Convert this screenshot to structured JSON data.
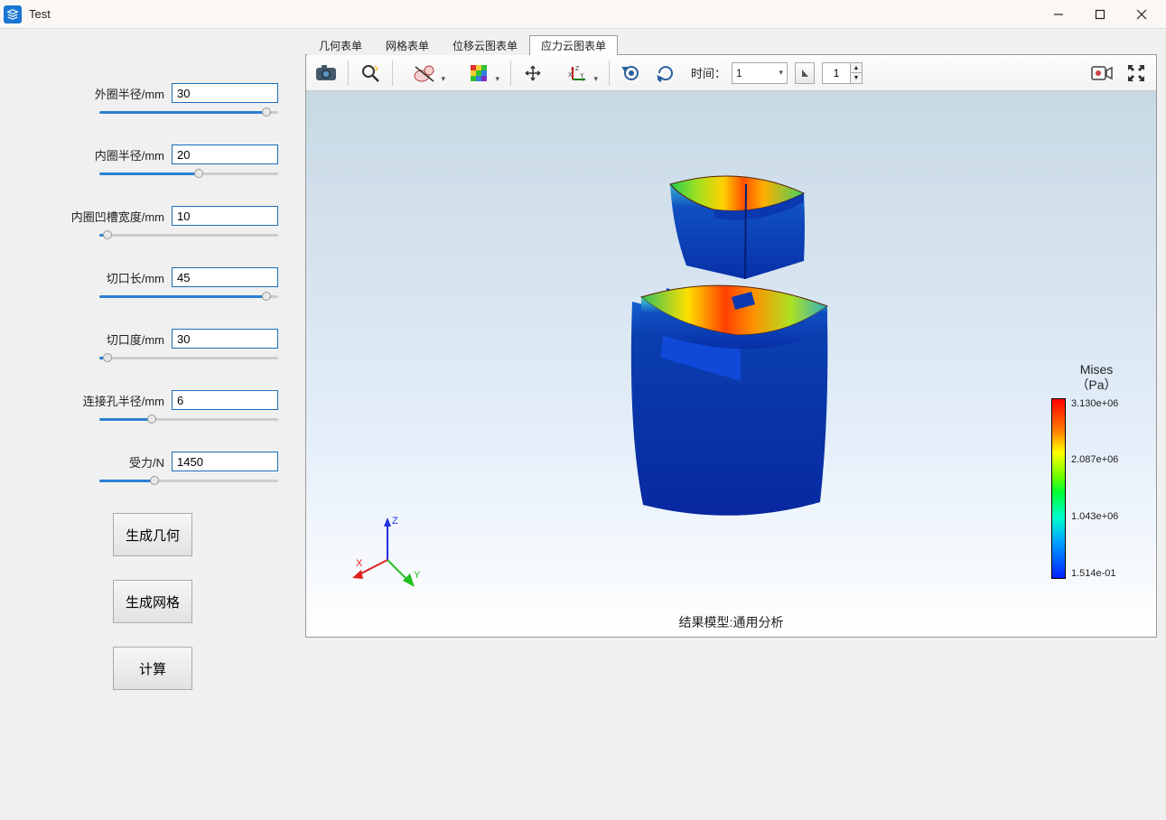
{
  "window": {
    "title": "Test"
  },
  "parameters": [
    {
      "label": "外圈半径/mm",
      "value": "30",
      "fill": "96%"
    },
    {
      "label": "内圈半径/mm",
      "value": "20",
      "fill": "56%"
    },
    {
      "label": "内圈凹槽宽度/mm",
      "value": "10",
      "fill": "2%"
    },
    {
      "label": "切口长/mm",
      "value": "45",
      "fill": "96%"
    },
    {
      "label": "切口度/mm",
      "value": "30",
      "fill": "2%"
    },
    {
      "label": "连接孔半径/mm",
      "value": "6",
      "fill": "28%"
    },
    {
      "label": "受力/N",
      "value": "1450",
      "fill": "30%"
    }
  ],
  "buttons": {
    "generate_geometry": "生成几何",
    "generate_mesh": "生成网格",
    "compute": "计算"
  },
  "tabs": [
    "几何表单",
    "网格表单",
    "位移云图表单",
    "应力云图表单"
  ],
  "active_tab": 3,
  "toolbar": {
    "time_label": "时间：",
    "time_value": "1",
    "frame_value": "1"
  },
  "viewport": {
    "result_label": "结果模型:通用分析",
    "legend": {
      "title_line1": "Mises",
      "title_line2": "（Pa）",
      "ticks": [
        "3.130e+06",
        "2.087e+06",
        "1.043e+06",
        "1.514e-01"
      ]
    },
    "axes": {
      "x": "X",
      "y": "Y",
      "z": "Z"
    }
  }
}
